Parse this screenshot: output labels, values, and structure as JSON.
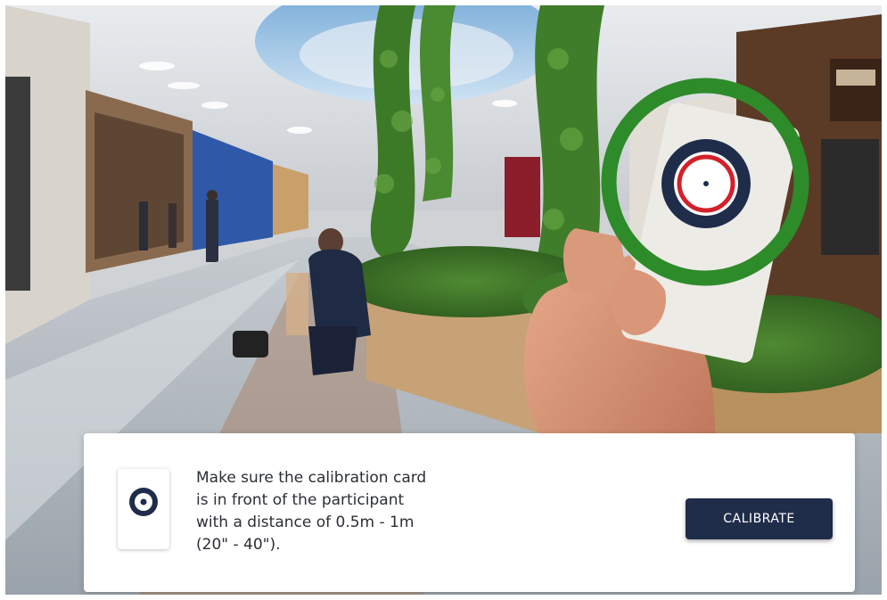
{
  "overlay": {
    "instruction_lines": [
      "Make sure the calibration card",
      "is in front of the participant",
      "with a distance of 0.5m - 1m",
      "(20\" - 40\")."
    ],
    "calibrate_label": "CALIBRATE"
  },
  "icons": {
    "card_target": "calibration-target-icon",
    "detection_ring": "detection-ring-icon"
  },
  "colors": {
    "detection_ring": "#2e8b2a",
    "button_background": "#1f2d4a",
    "target_ring": "#1f2d4a",
    "target_inner_ring": "#d4202a"
  }
}
